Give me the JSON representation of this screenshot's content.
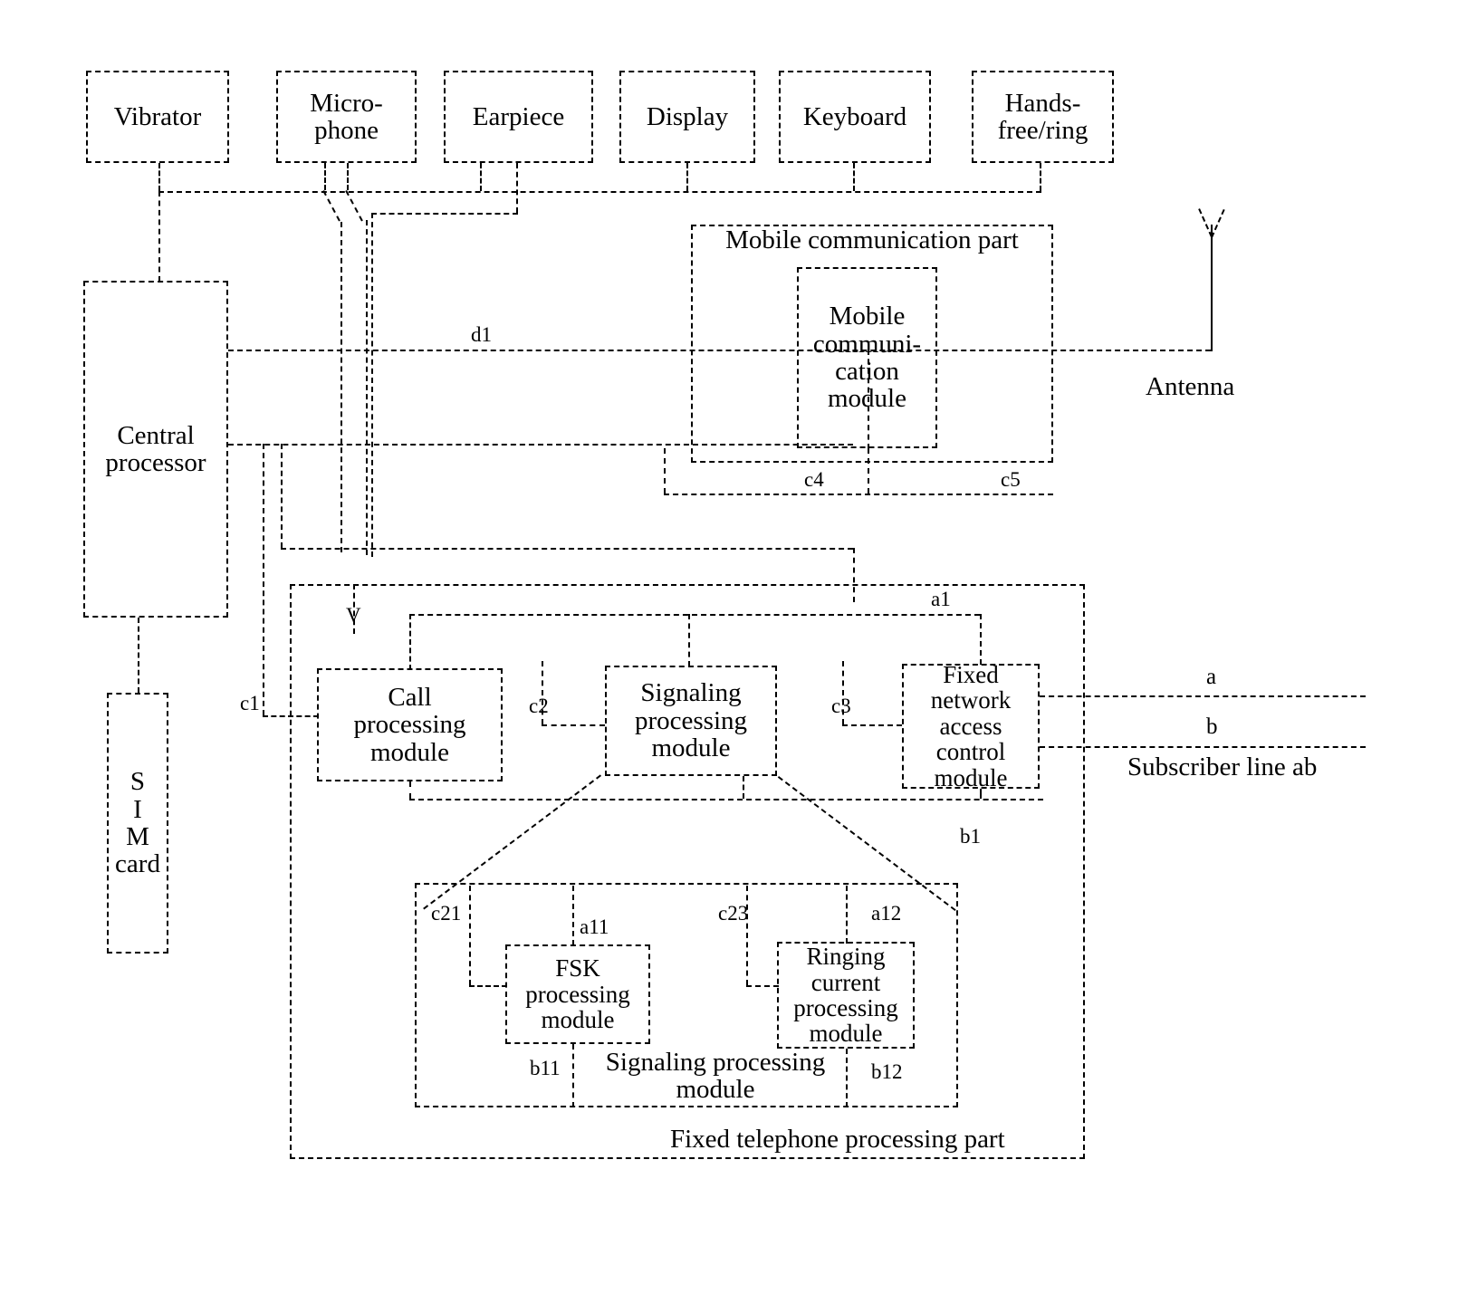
{
  "diagram": {
    "title": "Combined mobile and fixed telephone block diagram",
    "peripherals": [
      {
        "id": "vibrator",
        "label": "Vibrator"
      },
      {
        "id": "microphone",
        "label": "Micro-\nphone"
      },
      {
        "id": "earpiece",
        "label": "Earpiece"
      },
      {
        "id": "display",
        "label": "Display"
      },
      {
        "id": "keyboard",
        "label": "Keyboard"
      },
      {
        "id": "handsfree",
        "label": "Hands-\nfree/ring"
      }
    ],
    "core": {
      "central_processor": "Central\nprocessor",
      "sim_card": "S\nI\nM\ncard"
    },
    "mobile_part": {
      "group_label": "Mobile communication part",
      "module_label": "Mobile\ncommuni-\ncation\nmodule",
      "antenna_label": "Antenna"
    },
    "fixed_part": {
      "group_label": "Fixed telephone processing part",
      "call_processing": "Call\nprocessing\nmodule",
      "signaling_processing": "Signaling\nprocessing\nmodule",
      "fixed_network_access": "Fixed\nnetwork\naccess\ncontrol\nmodule",
      "subscriber_line": "Subscriber line ab"
    },
    "signaling_detail": {
      "group_label": "Signaling processing\nmodule",
      "fsk_module": "FSK\nprocessing\nmodule",
      "ringing_module": "Ringing\ncurrent\nprocessing\nmodule"
    },
    "refs": {
      "d1": "d1",
      "c1": "c1",
      "c2": "c2",
      "c3": "c3",
      "c4": "c4",
      "c5": "c5",
      "a1": "a1",
      "b1": "b1",
      "a": "a",
      "b": "b",
      "v": "V",
      "c21": "c21",
      "a11": "a11",
      "c23": "c23",
      "a12": "a12",
      "b11": "b11",
      "b12": "b12"
    },
    "colors": {
      "line": "#000000",
      "background": "#ffffff"
    }
  }
}
